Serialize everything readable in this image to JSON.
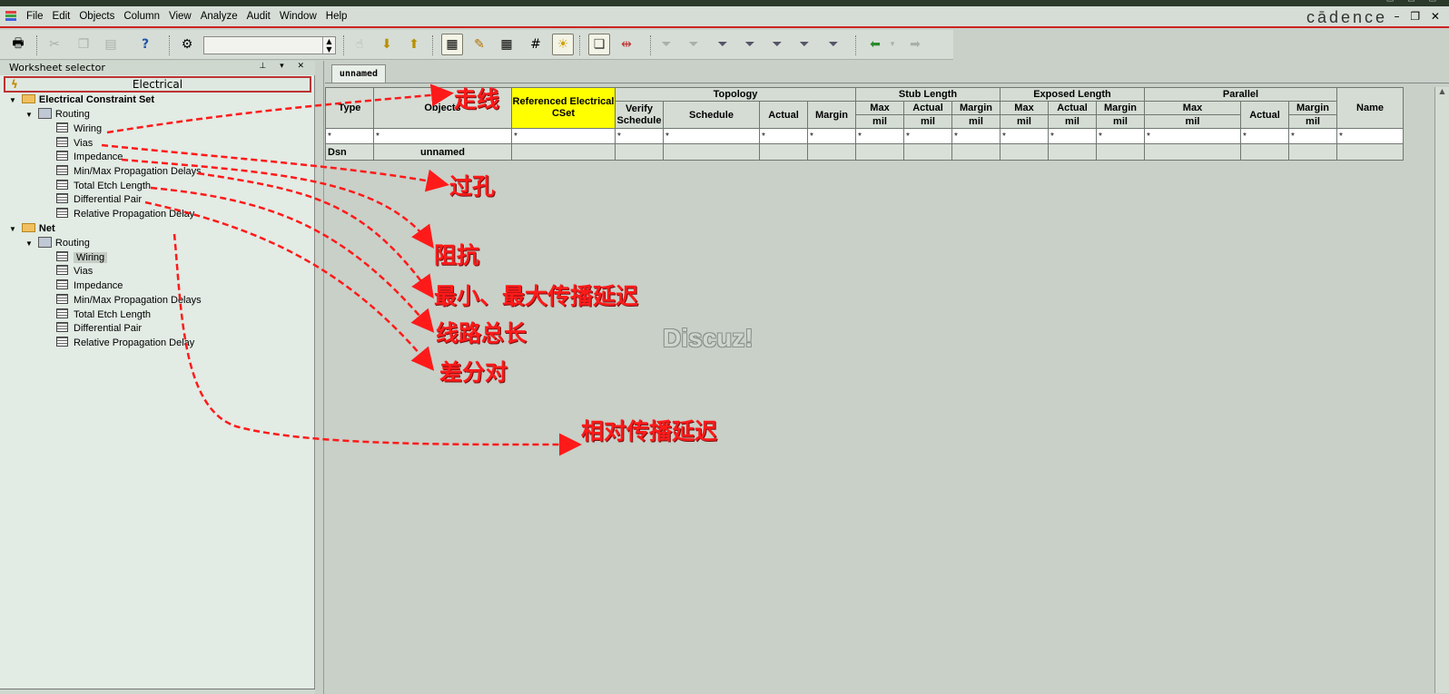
{
  "menu": [
    "File",
    "Edit",
    "Objects",
    "Column",
    "View",
    "Analyze",
    "Audit",
    "Window",
    "Help"
  ],
  "brand": "cādence",
  "window_controls": "– ❐ ✕",
  "worksheet_selector": {
    "title": "Worksheet selector",
    "pin_controls": "⊥ ▾ ✕",
    "domain_label": "Electrical"
  },
  "tree": {
    "cset_label": "Electrical Constraint Set",
    "cset_routing": "Routing",
    "cset_items": [
      "Wiring",
      "Vias",
      "Impedance",
      "Min/Max Propagation Delays",
      "Total Etch Length",
      "Differential Pair",
      "Relative Propagation Delay"
    ],
    "net_label": "Net",
    "net_routing": "Routing",
    "net_items": [
      "Wiring",
      "Vias",
      "Impedance",
      "Min/Max Propagation Delays",
      "Total Etch Length",
      "Differential Pair",
      "Relative Propagation Delay"
    ]
  },
  "tab_label": "unnamed",
  "grid": {
    "col_type": "Type",
    "col_objects": "Objects",
    "col_ref_cset": "Referenced Electrical CSet",
    "group_topology": "Topology",
    "group_stub": "Stub Length",
    "group_exposed": "Exposed Length",
    "group_parallel": "Parallel",
    "col_name": "Name",
    "verify_schedule": "Verify Schedule",
    "schedule": "Schedule",
    "actual": "Actual",
    "margin": "Margin",
    "max": "Max",
    "unit": "mil",
    "filter_char": "*",
    "row": {
      "type": "Dsn",
      "objects": "unnamed"
    }
  },
  "watermark": "Discuz!",
  "annotations": {
    "wiring": "走线",
    "vias": "过孔",
    "impedance": "阻抗",
    "minmax": "最小、最大传播延迟",
    "total_etch": "线路总长",
    "diff_pair": "差分对",
    "relative": "相对传播延迟"
  },
  "colors": {
    "accent": "#cc2222",
    "annotation": "#ff1a1a",
    "highlight": "#ffff00"
  }
}
